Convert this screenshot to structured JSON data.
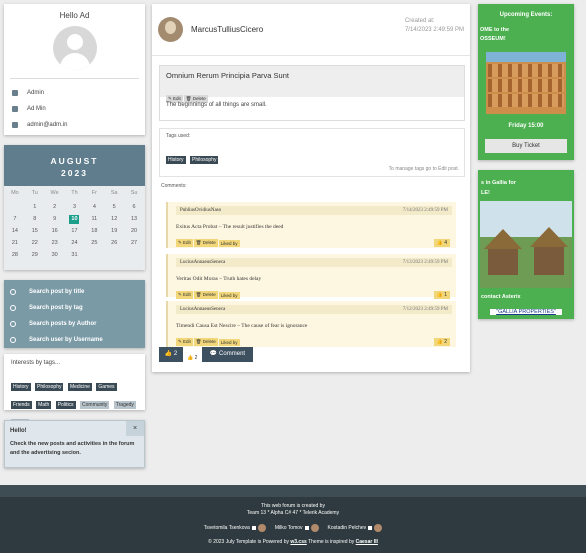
{
  "profile": {
    "greeting": "Hello Ad",
    "role": "Admin",
    "name": "Ad Min",
    "email": "admin@adm.in"
  },
  "calendar": {
    "month": "AUGUST",
    "year": "2023",
    "day_names": [
      "Mo",
      "Tu",
      "We",
      "Th",
      "Fr",
      "Sa",
      "Su"
    ],
    "weeks": [
      [
        "",
        "1",
        "2",
        "3",
        "4",
        "5",
        "6"
      ],
      [
        "7",
        "8",
        "9",
        "10",
        "11",
        "12",
        "13"
      ],
      [
        "14",
        "15",
        "16",
        "17",
        "18",
        "19",
        "20"
      ],
      [
        "21",
        "22",
        "23",
        "24",
        "25",
        "26",
        "27"
      ],
      [
        "28",
        "29",
        "30",
        "31",
        "",
        "",
        ""
      ]
    ],
    "today": "10"
  },
  "search_links": [
    {
      "label": "Search post by title",
      "icon": "search-icon"
    },
    {
      "label": "Search post by tag",
      "icon": "calendar-icon"
    },
    {
      "label": "Search posts by Author",
      "icon": "users-icon"
    },
    {
      "label": "Search user by Username",
      "icon": "settings-icon"
    }
  ],
  "interests": {
    "title": "Interests by tags...",
    "tags_dark": [
      "History",
      "Philosophy",
      "Medicine",
      "Games",
      "Friends",
      "Math",
      "Politics"
    ],
    "tags_light": [
      "Community",
      "Tragedy",
      "Forum"
    ],
    "tags_plain": [
      "Love"
    ]
  },
  "hello_box": {
    "title": "Hello!",
    "text": "Check the new posts and activities in the forum and the advertising secion.",
    "close": "×"
  },
  "post": {
    "author": "MarcusTulliusCicero",
    "created_label": "Created at:",
    "created_at": "7/14/2023 2:49:59 PM",
    "title": "Omnium Rerum Principia Parva Sunt",
    "edit": "✎ Edit",
    "delete": "🗑 Delete",
    "body": "The beginnings of all things are small.",
    "tags_label": "Tags used:",
    "tags": [
      "History",
      "Philosophy"
    ],
    "manage_note": "To manage tags go to Edit post.",
    "comments_label": "Comments:",
    "like_button": "👍 2",
    "like_count": "👍 2",
    "comment_button": "💬 Comment"
  },
  "comments": [
    {
      "author": "PubliusOvidiusNaso",
      "date": "7/14/2023 2:49:59 PM",
      "text": "Exitus Acta Probat – The result justifies the deed",
      "likes": "👍 4",
      "liked_by": "Liked by"
    },
    {
      "author": "LuciusAnnaeusSeneca",
      "date": "7/13/2023 2:49:59 PM",
      "text": "Veritas Odit Moras – Truth hates delay",
      "likes": "👍 1",
      "liked_by": "Liked by"
    },
    {
      "author": "LuciusAnnaeusSeneca",
      "date": "7/12/2023 2:49:59 PM",
      "text": "Timendi Causa Est Nescire – The cause of fear is ignorance",
      "likes": "👍 2",
      "liked_by": "Liked by"
    }
  ],
  "ads": {
    "events_title": "Upcoming Events:",
    "events_text": "OME to the\nOSSEUM!",
    "events_time": "Friday 15:00",
    "buy_ticket": "Buy Ticket",
    "gallia_title": "s in Gallia for\nLE!",
    "contact": "contact Asterix",
    "gallia_link": "\"GALLIA PROPERTIES\""
  },
  "footer": {
    "line1a": "This web forum is created by",
    "line1b": "Team 13 * Alpha C# 47 * Telerik Academy",
    "devs": [
      "Tsvetomila Tsenkova",
      "Milko Tomov",
      "Kostadin Pelchev"
    ],
    "line3a": "© 2023 July   Template is Powered by",
    "line3b": "w3.css",
    "line3c": "  Theme is inspired by",
    "line3d": "Caesar III"
  },
  "colors": {
    "accent_green": "#4caf50",
    "calendar_header": "#5f7d8c",
    "today": "#1d9e8a",
    "footer": "#2e3a3f"
  }
}
